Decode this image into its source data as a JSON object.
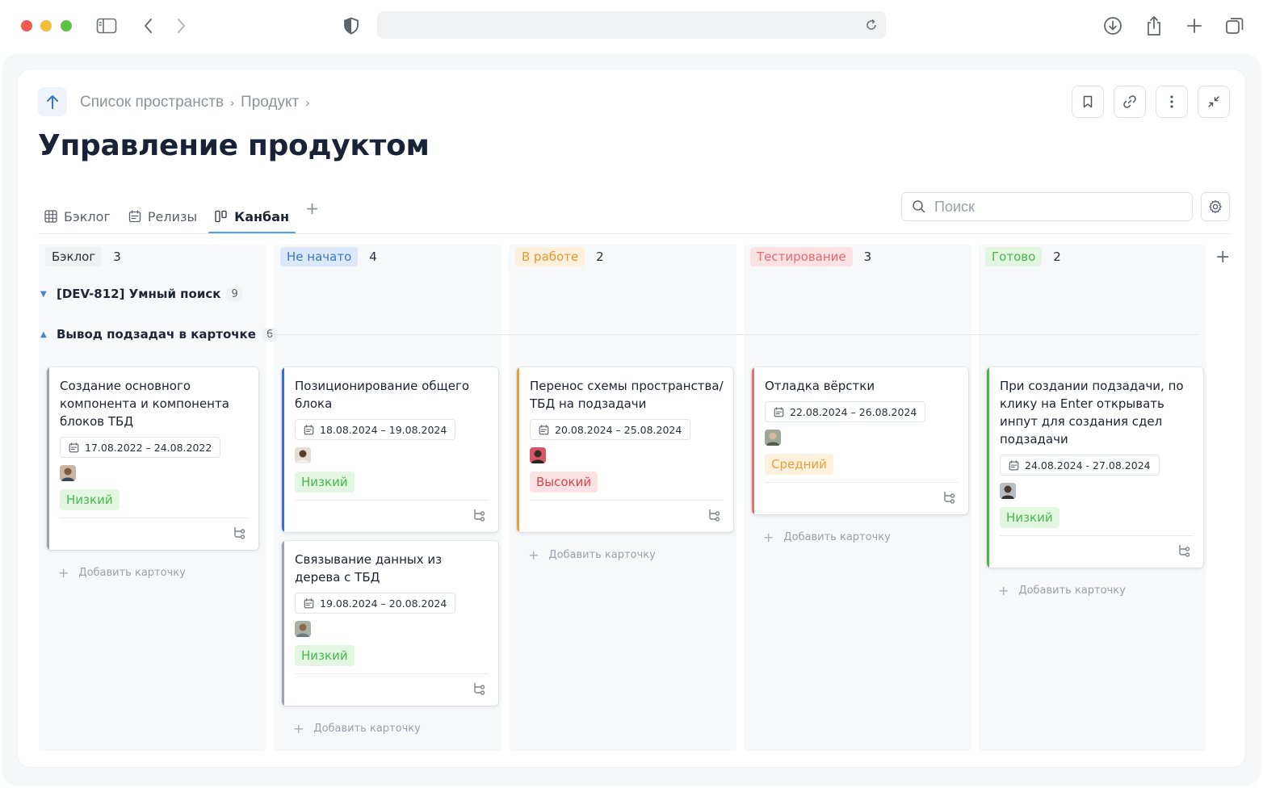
{
  "browser": {
    "icons": [
      "sidebar-icon",
      "back-icon",
      "forward-icon",
      "shield-icon",
      "reload-icon",
      "download-icon",
      "share-icon",
      "new-tab-icon",
      "tabs-icon"
    ]
  },
  "breadcrumb": {
    "items": [
      "Список пространств",
      "Продукт"
    ]
  },
  "page_title": "Управление продуктом",
  "tabs": [
    {
      "label": "Бэклог"
    },
    {
      "label": "Релизы"
    },
    {
      "label": "Канбан"
    }
  ],
  "tab_add": "+",
  "search": {
    "placeholder": "Поиск",
    "value": ""
  },
  "columns": [
    {
      "status": "Бэклог",
      "count": "3",
      "bg": "#f0f1f3",
      "fg": "#2a2f38"
    },
    {
      "status": "Не начато",
      "count": "4",
      "bg": "#dbe9fb",
      "fg": "#3e76c4"
    },
    {
      "status": "В работе",
      "count": "2",
      "bg": "#fdf0dc",
      "fg": "#e29a2e"
    },
    {
      "status": "Тестирование",
      "count": "3",
      "bg": "#fde2e3",
      "fg": "#e46a6f"
    },
    {
      "status": "Готово",
      "count": "2",
      "bg": "#e3f6e1",
      "fg": "#46b84b"
    }
  ],
  "add_column": "+",
  "groups": [
    {
      "title": "[DEV-812] Умный поиск",
      "count": "9",
      "expanded": false
    },
    {
      "title": "Вывод подзадач в карточке",
      "count": "6",
      "expanded": true
    }
  ],
  "cards": [
    {
      "title": "Создание основного компонента и компонента блоков ТБД",
      "dates": "17.08.2022 – 24.08.2022",
      "priority": "Низкий",
      "stripe": "#9ea3ab"
    },
    {
      "title": "Позиционирование общего блока",
      "dates": "18.08.2024 – 19.08.2024",
      "priority": "Низкий",
      "stripe": "#3a6fc8"
    },
    {
      "title": "Связывание данных из дерева с ТБД",
      "dates": "19.08.2024 – 20.08.2024",
      "priority": "Низкий",
      "stripe": "#9ea3ab"
    },
    {
      "title": "Перенос схемы пространства/ ТБД на подзадачи",
      "dates": "20.08.2024 – 25.08.2024",
      "priority": "Высокий",
      "stripe": "#e6a03a"
    },
    {
      "title": "Отладка вёрстки",
      "dates": "22.08.2024 – 26.08.2024",
      "priority": "Средний",
      "stripe": "#e9706f"
    },
    {
      "title": "При создании подзадачи, по клику на Enter открывать инпут для создания сдел подзадачи",
      "dates": "24.08.2024 - 27.08.2024",
      "priority": "Низкий",
      "stripe": "#46b84b"
    }
  ],
  "add_card_label": "Добавить карточку"
}
